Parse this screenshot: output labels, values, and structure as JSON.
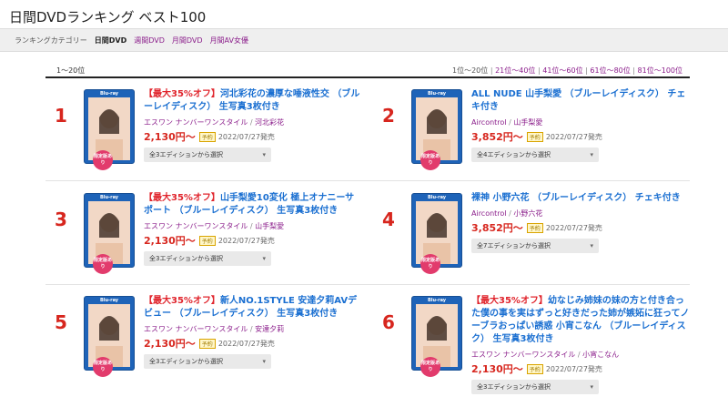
{
  "page": {
    "title": "日間DVDランキング ベスト100"
  },
  "categories": {
    "label": "ランキングカテゴリー",
    "items": [
      "日間DVD",
      "週間DVD",
      "月間DVD",
      "月間AV女優"
    ]
  },
  "range_label": "1〜20位",
  "pager": {
    "current": "1位〜20位",
    "links": [
      "21位〜40位",
      "41位〜60位",
      "61位〜80位",
      "81位〜100位"
    ]
  },
  "common": {
    "select_label_3": "全3エディションから選択",
    "badge": "限定版あり",
    "preorder": "予約",
    "release": "2022/07/27発売",
    "price_suffix": "〜"
  },
  "items": [
    {
      "rank": "1",
      "discount": "【最大35%オフ】",
      "title": "河北彩花の濃厚な唾液性交 （ブルーレイディスク） 生写真3枚付き",
      "maker": "エスワン ナンバーワンスタイル",
      "actress": "河北彩花",
      "price": "2,130円",
      "select": "全3エディションから選択"
    },
    {
      "rank": "2",
      "discount": "",
      "title": "ALL NUDE 山手梨愛 （ブルーレイディスク） チェキ付き",
      "maker": "Aircontrol",
      "actress": "山手梨愛",
      "price": "3,852円",
      "select": "全4エディションから選択"
    },
    {
      "rank": "3",
      "discount": "【最大35%オフ】",
      "title": "山手梨愛10変化 極上オナニーサポート （ブルーレイディスク） 生写真3枚付き",
      "maker": "エスワン ナンバーワンスタイル",
      "actress": "山手梨愛",
      "price": "2,130円",
      "select": "全3エディションから選択"
    },
    {
      "rank": "4",
      "discount": "",
      "title": "裸神 小野六花 （ブルーレイディスク） チェキ付き",
      "maker": "Aircontrol",
      "actress": "小野六花",
      "price": "3,852円",
      "select": "全7エディションから選択"
    },
    {
      "rank": "5",
      "discount": "【最大35%オフ】",
      "title": "新人NO.1STYLE 安達夕莉AVデビュー （ブルーレイディスク） 生写真3枚付き",
      "maker": "エスワン ナンバーワンスタイル",
      "actress": "安達夕莉",
      "price": "2,130円",
      "select": "全3エディションから選択"
    },
    {
      "rank": "6",
      "discount": "【最大35%オフ】",
      "title": "幼なじみ姉妹の妹の方と付き合った僕の事を実はずっと好きだった姉が嫉妬に狂ってノーブラおっぱい誘惑 小宵こなん （ブルーレイディスク） 生写真3枚付き",
      "maker": "エスワン ナンバーワンスタイル",
      "actress": "小宵こなん",
      "price": "2,130円",
      "select": "全3エディションから選択"
    }
  ],
  "colors": {
    "accent": "#d7261e",
    "link": "#1a6fd1",
    "category": "#8b1e8b",
    "case": "#1e63b8",
    "badge": "#e23b6c"
  }
}
